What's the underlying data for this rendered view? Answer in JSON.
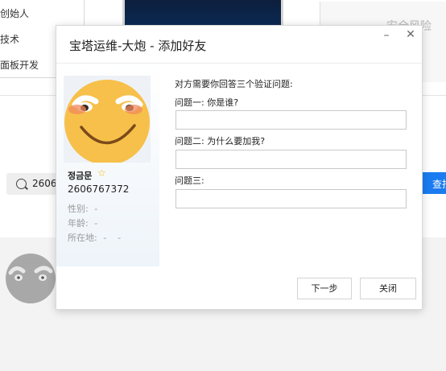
{
  "background": {
    "menu_items": [
      "创始人",
      "技术",
      "面板开发"
    ],
    "right_panel_text": "安全风险",
    "search_value": "2606",
    "search_button": "查找"
  },
  "dialog": {
    "title": "宝塔运维-大炮 - 添加好友",
    "minimize_glyph": "–",
    "close_glyph": "✕",
    "profile": {
      "name": "정금문",
      "uid": "2606767372",
      "gender_label": "性别:",
      "gender_value": "-",
      "age_label": "年龄:",
      "age_value": "-",
      "location_label": "所在地:",
      "location_value": "-    -"
    },
    "intro": "对方需要你回答三个验证问题:",
    "questions": [
      {
        "label": "问题一: 你是谁?",
        "answer": ""
      },
      {
        "label": "问题二: 为什么要加我?",
        "answer": ""
      },
      {
        "label": "问题三:",
        "answer": ""
      }
    ],
    "next_button": "下一步",
    "close_button": "关闭"
  },
  "colors": {
    "accent": "#1a7cf0",
    "star": "#f2b600",
    "smiley_face": "#f7c04a"
  },
  "icons": {
    "avatar": "smiley-face-icon",
    "star": "star-icon",
    "search": "search-icon",
    "minimize": "minimize-icon",
    "close": "close-icon"
  }
}
